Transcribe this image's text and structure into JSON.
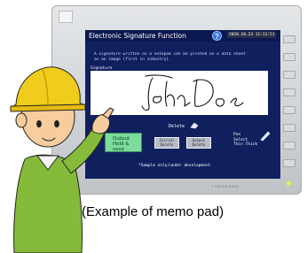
{
  "screen": {
    "title": "Electronic Signature Function",
    "help_label": "?",
    "datetime": "2020.10.23 11:11:51",
    "instructions": [
      "A signature written on a notepad can be printed on a data sheet",
      "as an image (first in industry)."
    ],
    "signature_label": "Signature",
    "signature_text": "John Doe",
    "delete_label": "Delete",
    "output_button": [
      "Output",
      "Hold & save"
    ],
    "buttons": [
      {
        "line1": "Initial",
        "line2": "Delete"
      },
      {
        "line1": "Output",
        "line2": "Delete"
      }
    ],
    "pen_select": [
      "Pen",
      "Select",
      "Thin  Thick"
    ],
    "sample_note": "*Sample only/under development",
    "brand": "YOKOGAWA"
  },
  "caption": "(Example of memo pad)",
  "colors": {
    "screen_bg": "#10205f",
    "title_bar": "#0c1850",
    "output_button": "#7bdc9c",
    "helmet": "#f0cc1c"
  }
}
